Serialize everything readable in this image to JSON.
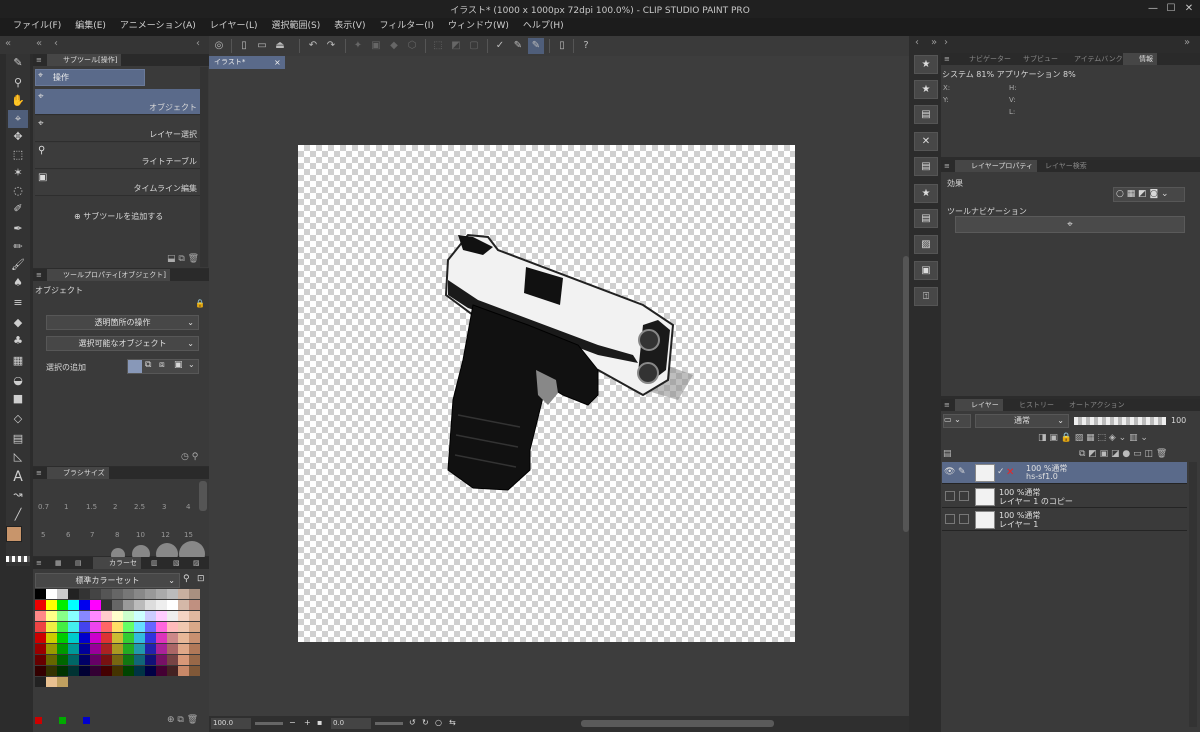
{
  "title": "イラスト* (1000 x 1000px 72dpi 100.0%)  - CLIP STUDIO PAINT PRO",
  "menu": [
    "ファイル(F)",
    "編集(E)",
    "アニメーション(A)",
    "レイヤー(L)",
    "選択範囲(S)",
    "表示(V)",
    "フィルター(I)",
    "ウィンドウ(W)",
    "ヘルプ(H)"
  ],
  "document_tab": "イラスト*",
  "subtool_panel": {
    "tab": "サブツール[操作]",
    "group": "操作",
    "items": [
      "オブジェクト",
      "レイヤー選択",
      "ライトテーブル",
      "タイムライン編集"
    ],
    "add_label": "サブツールを追加する"
  },
  "tool_property": {
    "tab": "ツールプロパティ[オブジェクト]",
    "title": "オブジェクト",
    "dropdown1": "透明箇所の操作",
    "dropdown2": "選択可能なオブジェクト",
    "add_selection_label": "選択の追加"
  },
  "brush_size": {
    "tab": "ブラシサイズ",
    "row1": [
      "0.7",
      "1",
      "1.5",
      "2",
      "2.5",
      "3",
      "4"
    ],
    "row2": [
      "5",
      "6",
      "7",
      "8",
      "10",
      "12",
      "15"
    ]
  },
  "color_panel": {
    "tab": "カラーセ",
    "set_name": "標準カラーセット"
  },
  "navigator": {
    "tabs": [
      "ナビゲーター",
      "サブビュー",
      "アイテムバンク",
      "情報"
    ],
    "system_text": "システム 81%  アプリケーション 8%",
    "labels": [
      "X:",
      "Y:",
      "H:",
      "V:",
      "L:"
    ]
  },
  "layer_property": {
    "tabs": [
      "レイヤープロパティ",
      "レイヤー検索"
    ],
    "effect_label": "効果",
    "tool_nav_label": "ツールナビゲーション"
  },
  "layer_panel": {
    "tabs": [
      "レイヤー",
      "ヒストリー",
      "オートアクション"
    ],
    "blend_mode": "通常",
    "opacity": "100",
    "layers": [
      {
        "line1": "100 %通常",
        "line2": "hs-sf1.0",
        "selected": true
      },
      {
        "line1": "100 %通常",
        "line2": "レイヤー 1 のコピー",
        "selected": false
      },
      {
        "line1": "100 %通常",
        "line2": "レイヤー 1",
        "selected": false
      }
    ]
  },
  "status": {
    "zoom": "100.0",
    "angle": "0.0"
  },
  "colors": {
    "accent": "#4f5e7a",
    "main_color": "#c8956b",
    "sub_color": "#d9a070"
  }
}
